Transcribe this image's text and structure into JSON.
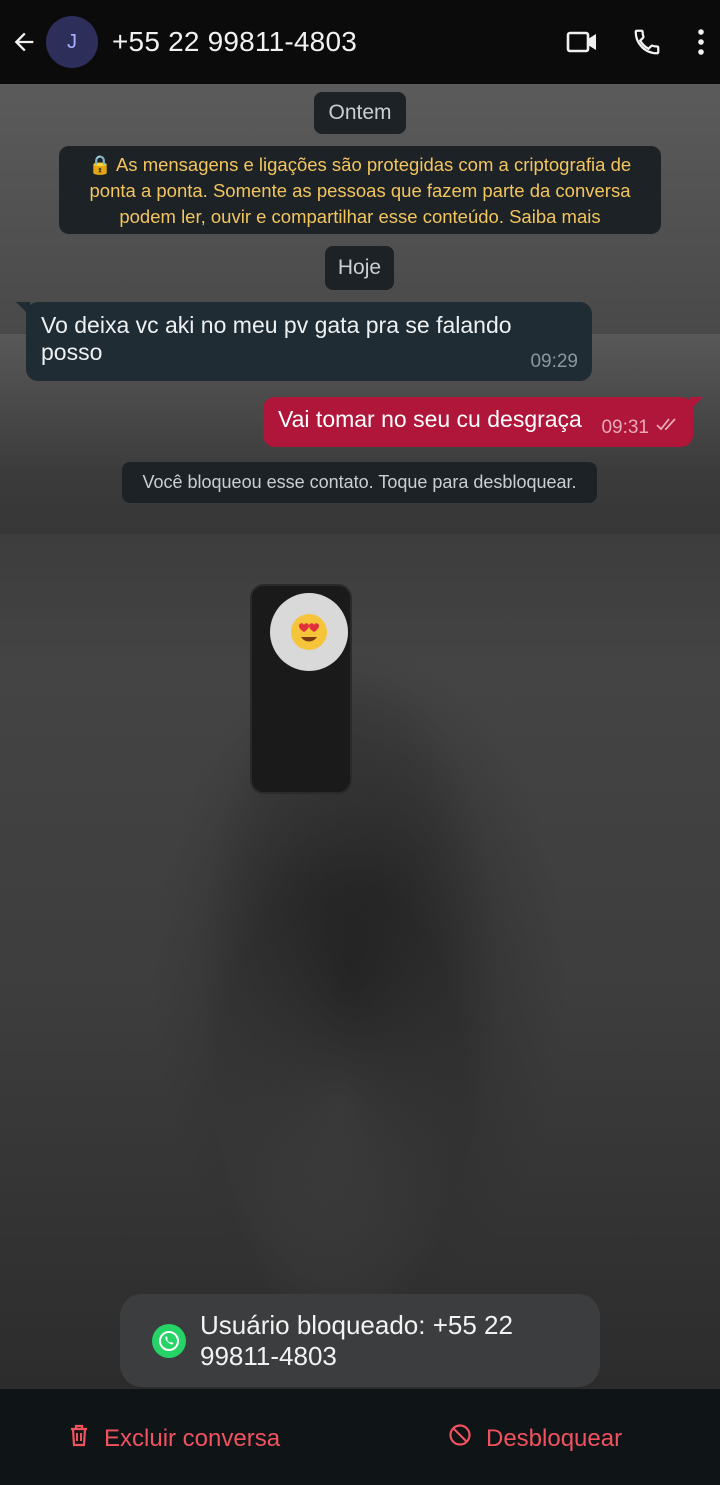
{
  "header": {
    "avatar_initial": "J",
    "contact_name": "+55 22 99811-4803",
    "icons": [
      "back-arrow-icon",
      "video-call-icon",
      "phone-call-icon",
      "more-vert-icon"
    ]
  },
  "chat": {
    "date_ontem": "Ontem",
    "encryption_notice": "🔒 As mensagens e ligações são protegidas com a criptografia de ponta a ponta. Somente as pessoas que fazem parte da conversa podem ler, ouvir e compartilhar esse conteúdo. Saiba mais",
    "date_hoje": "Hoje",
    "messages": [
      {
        "direction": "incoming",
        "text": "Vo deixa vc aki no meu pv gata pra se falando posso",
        "time": "09:29"
      },
      {
        "direction": "outgoing",
        "text": "Vai tomar no seu cu desgraça",
        "time": "09:31",
        "status_icon": "double-check-icon"
      }
    ],
    "blocked_notice": "Você bloqueou esse contato. Toque para desbloquear."
  },
  "toast": {
    "text": "Usuário bloqueado: +55 22 99811-4803",
    "icon": "whatsapp-icon"
  },
  "bottom_bar": {
    "delete_label": "Excluir conversa",
    "unblock_label": "Desbloquear",
    "accent": "#f0525f"
  },
  "colors": {
    "outgoing_bubble": "#b0153a",
    "incoming_bubble": "#1f2c33",
    "encryption_text": "#f3c55e"
  }
}
